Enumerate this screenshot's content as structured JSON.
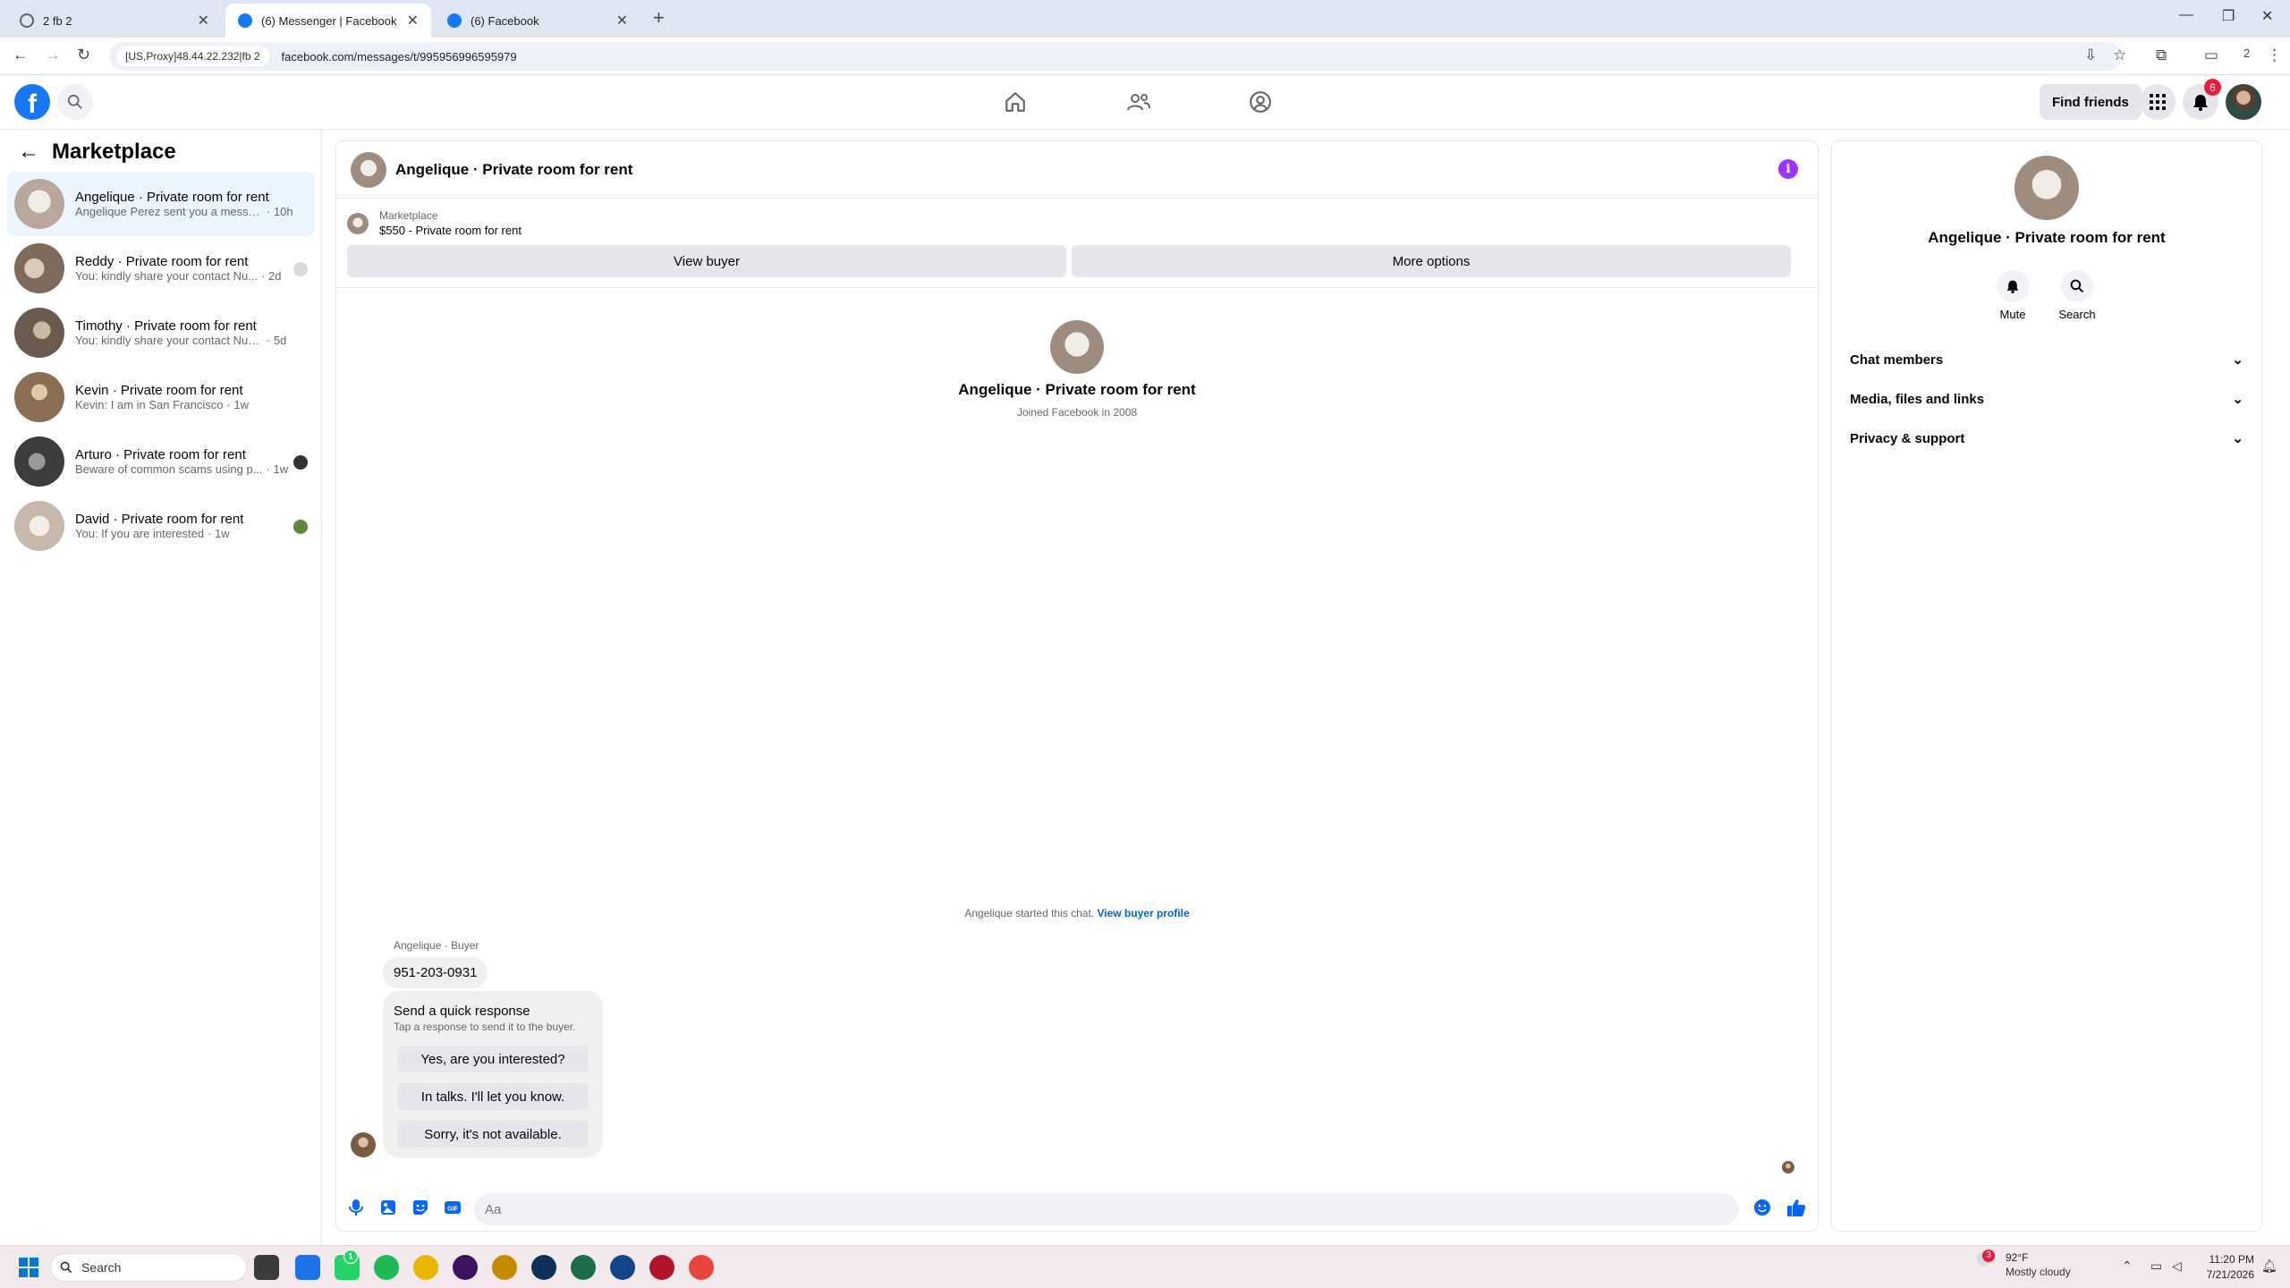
{
  "browser": {
    "tabs": [
      {
        "title": "2 fb 2",
        "active": false
      },
      {
        "title": "(6) Messenger | Facebook",
        "active": true
      },
      {
        "title": "(6) Facebook",
        "active": false
      }
    ],
    "proxy_chip": "[US,Proxy]48.44.22.232|fb 2",
    "url": "facebook.com/messages/t/995956996595979",
    "profile_num": "2"
  },
  "fbnav": {
    "find_friends": "Find friends",
    "notifications_count": "6"
  },
  "sidebar": {
    "title": "Marketplace",
    "conversations": [
      {
        "name": "Angelique · Private room for rent",
        "preview": "Angelique Perez sent you a message...",
        "time": "· 10h",
        "color": "#b9a89a"
      },
      {
        "name": "Reddy · Private room for rent",
        "preview": "You: kindly share your contact Nu...",
        "time": "· 2d",
        "color": "#7d6a5a"
      },
      {
        "name": "Timothy · Private room for rent",
        "preview": "You: kindly share your contact Numbe...",
        "time": "· 5d",
        "color": "#6b5b4f"
      },
      {
        "name": "Kevin · Private room for rent",
        "preview": "Kevin: I am in San Francisco",
        "time": "· 1w",
        "color": "#8a6f55"
      },
      {
        "name": "Arturo · Private room for rent",
        "preview": "Beware of common scams using p...",
        "time": "· 1w",
        "color": "#4d4d4d"
      },
      {
        "name": "David · Private room for rent",
        "preview": "You: If you are interested",
        "time": "· 1w",
        "color": "#c8b9ab"
      }
    ]
  },
  "chat": {
    "title": "Angelique · Private room for rent",
    "listing_source": "Marketplace",
    "listing_price": "$550 - Private room for rent",
    "view_buyer": "View buyer",
    "more_options": "More options",
    "intro_name": "Angelique · Private room for rent",
    "intro_sub": "Joined Facebook in 2008",
    "started_text": "Angelique started this chat.",
    "view_buyer_profile": "View buyer profile",
    "sender_label": "Angelique · Buyer",
    "phone_message": "951-203-0931",
    "quick_title": "Send a quick response",
    "quick_sub": "Tap a response to send it to the buyer.",
    "quick_responses": [
      "Yes, are you interested?",
      "In talks. I'll let you know.",
      "Sorry, it's not available."
    ],
    "composer_placeholder": "Aa"
  },
  "rpanel": {
    "name": "Angelique · Private room for rent",
    "mute": "Mute",
    "search": "Search",
    "sections": [
      "Chat members",
      "Media, files and links",
      "Privacy & support"
    ]
  },
  "taskbar": {
    "search": "Search",
    "weather_temp": "92°F",
    "weather_desc": "Mostly cloudy",
    "weather_badge": "3",
    "whatsapp_badge": "1",
    "time": "11:20 PM",
    "date": "7/21/2026"
  },
  "colors": {
    "fb_blue": "#1877f2",
    "active_conv": "#ebf5ff",
    "info_purple": "#a033ff",
    "badge_red": "#e41e3f"
  }
}
